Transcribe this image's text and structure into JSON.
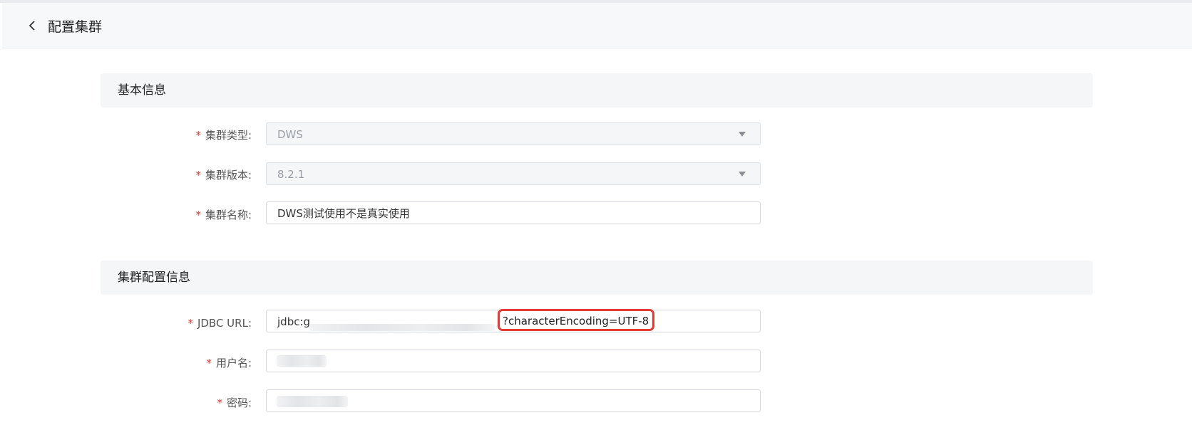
{
  "header": {
    "back_icon": "chevron-left-icon",
    "title": "配置集群"
  },
  "basic_info": {
    "section_title": "基本信息",
    "cluster_type": {
      "label": "集群类型:",
      "value": "DWS"
    },
    "cluster_version": {
      "label": "集群版本:",
      "value": "8.2.1"
    },
    "cluster_name": {
      "label": "集群名称:",
      "value": "DWS测试使用不是真实使用"
    }
  },
  "cluster_config": {
    "section_title": "集群配置信息",
    "jdbc_url": {
      "label": "JDBC URL:",
      "value_prefix": "jdbc:g",
      "value_suffix": "?characterEncoding=UTF-8"
    },
    "username": {
      "label": "用户名:"
    },
    "password": {
      "label": "密码:"
    }
  },
  "required_mark": "*",
  "colors": {
    "required": "#e0342f",
    "highlight": "#e53935"
  }
}
